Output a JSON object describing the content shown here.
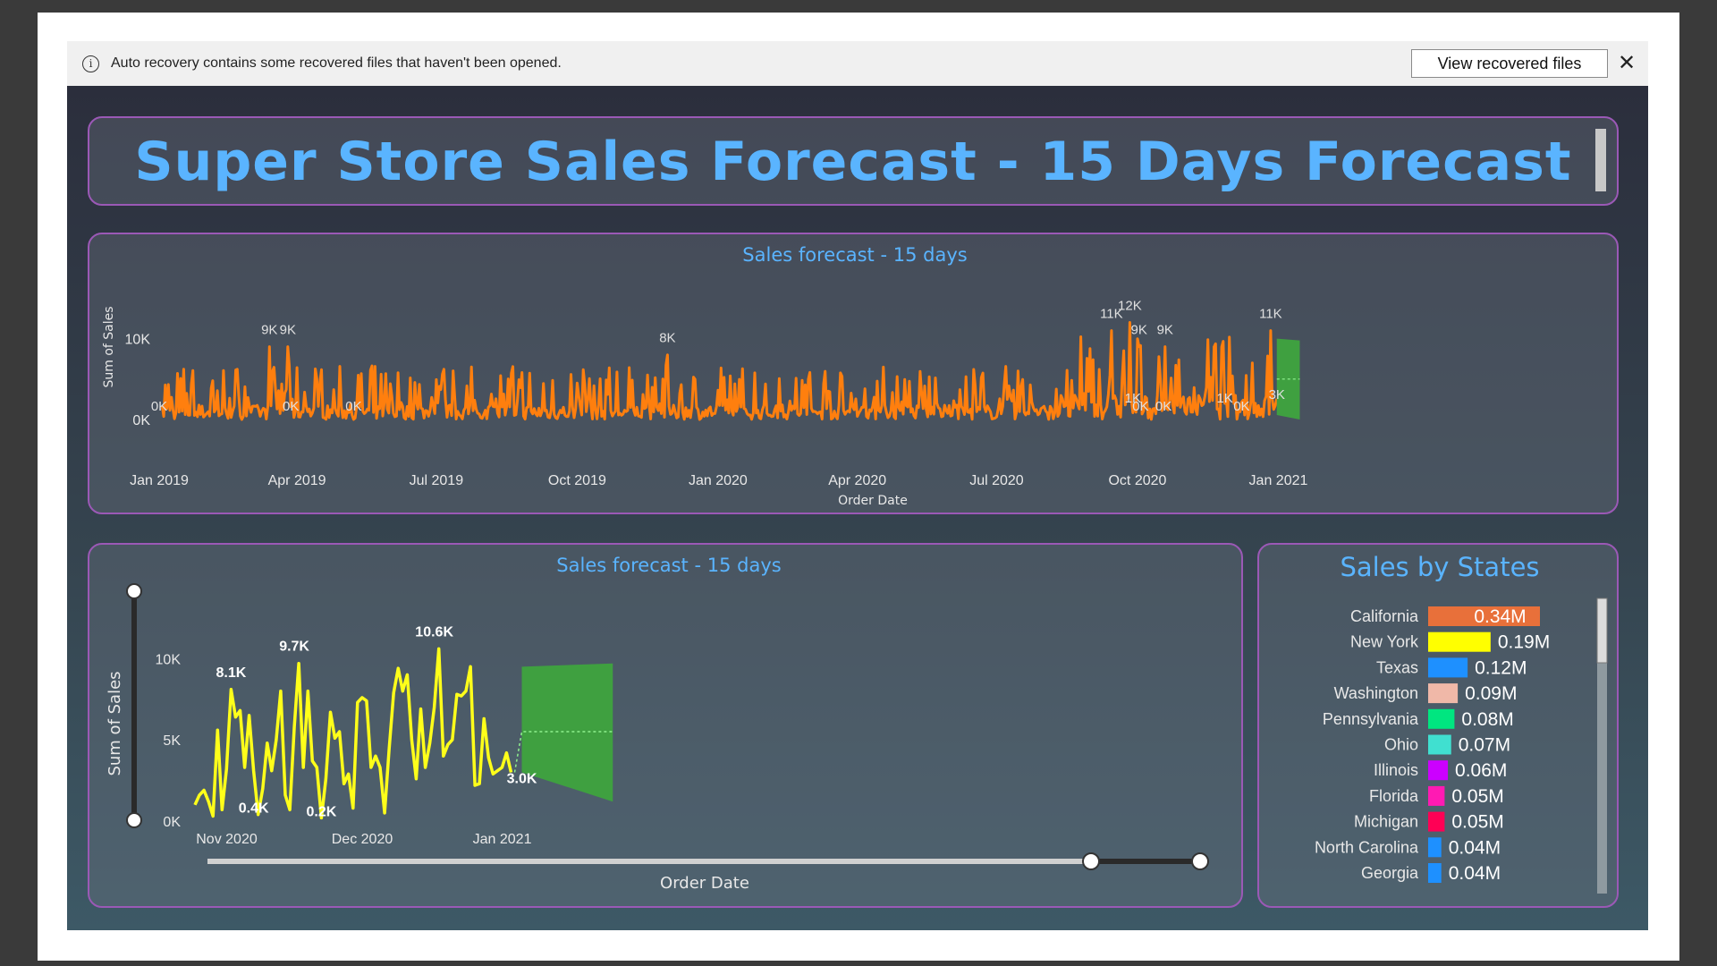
{
  "banner": {
    "message": "Auto recovery contains some recovered files that haven't been opened.",
    "view_button": "View recovered files",
    "info_glyph": "i",
    "close_glyph": "✕"
  },
  "dashboard": {
    "title": "Super Store Sales Forecast - 15 Days Forecast"
  },
  "colors": {
    "accent_title": "#5ab4ff",
    "panel_border": "#9b59b6",
    "series_top": "#ff7f0e",
    "series_bottom": "#ffff1a",
    "forecast": "#3fa040"
  },
  "chart_data": [
    {
      "id": "top",
      "type": "line",
      "title": "Sales forecast - 15 days",
      "xlabel": "Order Date",
      "ylabel": "Sum of Sales",
      "y_ticks": [
        "0K",
        "10K"
      ],
      "ylim": [
        0,
        12500
      ],
      "x_ticks": [
        "Jan 2019",
        "Apr 2019",
        "Jul 2019",
        "Oct 2019",
        "Jan 2020",
        "Apr 2020",
        "Jul 2020",
        "Oct 2020",
        "Jan 2021"
      ],
      "xlim": [
        "2019-01-01",
        "2021-01-20"
      ],
      "series_color": "#ff7f0e",
      "labels": [
        {
          "date": "2019-03-14",
          "value": 9000,
          "text": "9K"
        },
        {
          "date": "2019-03-26",
          "value": 9000,
          "text": "9K"
        },
        {
          "date": "2019-11-29",
          "value": 8000,
          "text": "8K"
        },
        {
          "date": "2020-09-14",
          "value": 11000,
          "text": "11K"
        },
        {
          "date": "2020-09-26",
          "value": 12000,
          "text": "12K"
        },
        {
          "date": "2020-10-02",
          "value": 9000,
          "text": "9K"
        },
        {
          "date": "2020-10-19",
          "value": 9000,
          "text": "9K"
        },
        {
          "date": "2020-12-27",
          "value": 11000,
          "text": "11K"
        },
        {
          "date": "2019-01-01",
          "value": 0,
          "text": "0K"
        },
        {
          "date": "2019-03-28",
          "value": 0,
          "text": "0K"
        },
        {
          "date": "2019-05-08",
          "value": 0,
          "text": "0K"
        },
        {
          "date": "2020-09-28",
          "value": 1000,
          "text": "1K"
        },
        {
          "date": "2020-10-03",
          "value": 0,
          "text": "0K"
        },
        {
          "date": "2020-10-18",
          "value": 0,
          "text": "0K"
        },
        {
          "date": "2020-11-27",
          "value": 1000,
          "text": "1K"
        },
        {
          "date": "2020-12-08",
          "value": 0,
          "text": "0K"
        },
        {
          "date": "2020-12-31",
          "value": 3000,
          "text": "3K"
        }
      ],
      "forecast": {
        "start": "2020-12-31",
        "end": "2021-01-15",
        "lower": 0,
        "upper": 10000,
        "center": 5000
      }
    },
    {
      "id": "bottom",
      "type": "line",
      "title": "Sales forecast - 15 days",
      "xlabel": "Order Date",
      "ylabel": "Sum of Sales",
      "y_ticks": [
        "0K",
        "5K",
        "10K"
      ],
      "ylim": [
        0,
        11500
      ],
      "x_ticks": [
        "Nov 2020",
        "Dec 2020",
        "Jan 2021"
      ],
      "series_color": "#ffff1a",
      "x": [
        "2020-10-22",
        "2020-10-23",
        "2020-10-24",
        "2020-10-25",
        "2020-10-26",
        "2020-10-27",
        "2020-10-28",
        "2020-10-29",
        "2020-10-30",
        "2020-10-31",
        "2020-11-01",
        "2020-11-02",
        "2020-11-03",
        "2020-11-04",
        "2020-11-05",
        "2020-11-06",
        "2020-11-07",
        "2020-11-08",
        "2020-11-09",
        "2020-11-10",
        "2020-11-11",
        "2020-11-12",
        "2020-11-13",
        "2020-11-14",
        "2020-11-15",
        "2020-11-16",
        "2020-11-17",
        "2020-11-18",
        "2020-11-19",
        "2020-11-20",
        "2020-11-21",
        "2020-11-22",
        "2020-11-23",
        "2020-11-24",
        "2020-11-25",
        "2020-11-26",
        "2020-11-27",
        "2020-11-28",
        "2020-11-29",
        "2020-11-30",
        "2020-12-01",
        "2020-12-02",
        "2020-12-03",
        "2020-12-04",
        "2020-12-05",
        "2020-12-06",
        "2020-12-07",
        "2020-12-08",
        "2020-12-09",
        "2020-12-10",
        "2020-12-11",
        "2020-12-12",
        "2020-12-13",
        "2020-12-14",
        "2020-12-15",
        "2020-12-16",
        "2020-12-17",
        "2020-12-18",
        "2020-12-19",
        "2020-12-20",
        "2020-12-21",
        "2020-12-22",
        "2020-12-23",
        "2020-12-24",
        "2020-12-25",
        "2020-12-26",
        "2020-12-27",
        "2020-12-28",
        "2020-12-29",
        "2020-12-30",
        "2020-12-31"
      ],
      "values": [
        1000,
        1600,
        1900,
        1200,
        300,
        5600,
        700,
        3200,
        8100,
        6400,
        6800,
        3300,
        6500,
        3100,
        400,
        2000,
        4800,
        3100,
        5000,
        8000,
        1600,
        700,
        5800,
        9700,
        3300,
        8000,
        3700,
        3300,
        200,
        2600,
        6700,
        5100,
        5500,
        2300,
        2900,
        800,
        7300,
        7600,
        7400,
        3300,
        4000,
        3300,
        500,
        4400,
        7900,
        9400,
        8000,
        9000,
        5000,
        2600,
        6900,
        3300,
        4800,
        7000,
        10600,
        4000,
        4700,
        5000,
        7800,
        7700,
        8000,
        9500,
        2200,
        2300,
        6300,
        3900,
        2900,
        3100,
        3300,
        4200,
        3000
      ],
      "labels": [
        {
          "date": "2020-10-30",
          "value": 8100,
          "text": "8.1K"
        },
        {
          "date": "2020-11-13",
          "value": 9700,
          "text": "9.7K"
        },
        {
          "date": "2020-12-14",
          "value": 10600,
          "text": "10.6K"
        },
        {
          "date": "2020-11-04",
          "value": 400,
          "text": "0.4K"
        },
        {
          "date": "2020-11-19",
          "value": 200,
          "text": "0.2K"
        },
        {
          "date": "2020-12-31",
          "value": 3000,
          "text": "3.0K"
        }
      ],
      "forecast": {
        "start": "2020-12-31",
        "end": "2021-01-15",
        "lower_start": 3000,
        "upper_start": 9500,
        "lower_end": 1200,
        "upper_end": 9700,
        "center": 5500
      }
    },
    {
      "id": "states",
      "type": "bar",
      "title": "Sales by States",
      "categories": [
        "California",
        "New York",
        "Texas",
        "Washington",
        "Pennsylvania",
        "Ohio",
        "Illinois",
        "Florida",
        "Michigan",
        "North Carolina",
        "Georgia"
      ],
      "values": [
        0.34,
        0.19,
        0.12,
        0.09,
        0.08,
        0.07,
        0.06,
        0.05,
        0.05,
        0.04,
        0.04
      ],
      "value_labels": [
        "0.34M",
        "0.19M",
        "0.12M",
        "0.09M",
        "0.08M",
        "0.07M",
        "0.06M",
        "0.05M",
        "0.05M",
        "0.04M",
        "0.04M"
      ],
      "colors": [
        "#e8703a",
        "#ffff00",
        "#1e90ff",
        "#f0b8a8",
        "#00e680",
        "#40e0d0",
        "#cc00ff",
        "#ff1ab3",
        "#ff0055",
        "#1e90ff",
        "#1e90ff"
      ],
      "unit": "M"
    }
  ]
}
